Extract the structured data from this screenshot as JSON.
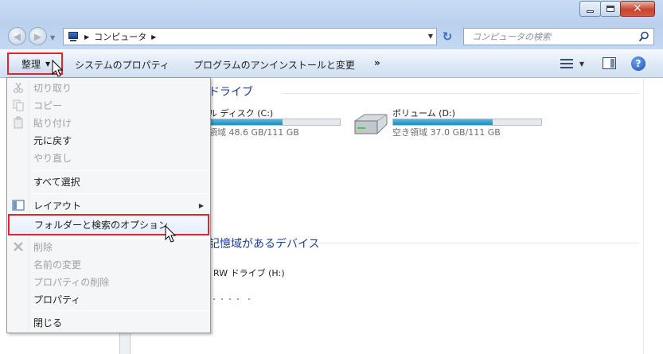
{
  "window": {
    "controls": {
      "minimize": "minimize-icon",
      "maximize": "maximize-icon",
      "close": "✕"
    }
  },
  "nav": {
    "address_crumb": "コンピュータ",
    "search_placeholder": "コンピュータの検索"
  },
  "toolbar": {
    "organize_label": "整理",
    "items": [
      "システムのプロパティ",
      "プログラムのアンインストールと変更"
    ],
    "more_label": "»"
  },
  "content": {
    "groups": [
      {
        "title": "ドライブ",
        "visible_title": "ドライブ"
      },
      {
        "visible_title": "記憶域があるデバイス"
      }
    ],
    "drives": [
      {
        "name": "ル ディスク (C:)",
        "free_text": "領域 48.6 GB/111 GB",
        "used_fraction": 0.56
      },
      {
        "name": "ボリューム (D:)",
        "free_text": "空き領域 37.0 GB/111 GB",
        "used_fraction": 0.67
      }
    ],
    "devices": [
      {
        "name": "RW ドライブ (H:)"
      }
    ]
  },
  "menu": {
    "items": [
      {
        "label": "切り取り",
        "icon": "scissors-icon",
        "enabled": false
      },
      {
        "label": "コピー",
        "icon": "copy-icon",
        "enabled": false
      },
      {
        "label": "貼り付け",
        "icon": "paste-icon",
        "enabled": false
      },
      {
        "label": "元に戻す",
        "enabled": true
      },
      {
        "label": "やり直し",
        "enabled": false
      },
      {
        "label": "すべて選択",
        "enabled": true
      },
      {
        "label": "レイアウト",
        "icon": "layout-icon",
        "enabled": true,
        "submenu": true
      },
      {
        "label": "フォルダーと検索のオプション",
        "enabled": true,
        "highlighted": true
      },
      {
        "label": "削除",
        "icon": "delete-icon",
        "enabled": false
      },
      {
        "label": "名前の変更",
        "enabled": false
      },
      {
        "label": "プロパティの削除",
        "enabled": false
      },
      {
        "label": "プロパティ",
        "enabled": true
      },
      {
        "label": "閉じる",
        "enabled": true
      }
    ]
  },
  "colors": {
    "highlight_border": "#e3252b",
    "group_title": "#1e3d8f",
    "drive_fill": "#1c8cc2"
  }
}
